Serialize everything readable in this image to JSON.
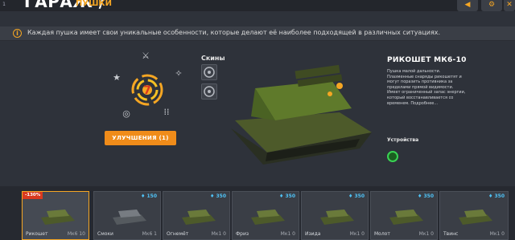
{
  "header": {
    "title": "ГАРАЖ /",
    "subtitle": "ПУШКИ",
    "left_tag": "1"
  },
  "info": {
    "icon": "i",
    "text": "Каждая пушка имеет свои уникальные особенности, которые делают её наиболее подходящей в различных ситуациях."
  },
  "upgrades": {
    "button_label": "УЛУЧШЕНИЯ (1)",
    "center_value": "7"
  },
  "skins": {
    "label": "Скины"
  },
  "weapon": {
    "name": "РИКОШЕТ МК6-10",
    "description": "Пушка малой дальности. Плазменные снаряды рикошетят и могут поразить противника за пределами прямой видимости. Имеет ограниченный запас энергии, который восстанавливается со временем. Подробнее..."
  },
  "devices": {
    "label": "Устройства"
  },
  "cards": [
    {
      "name": "Рикошет",
      "mk": "Мк6 10",
      "badge": "-130%",
      "price": ""
    },
    {
      "name": "Смоки",
      "mk": "Мк6 1",
      "badge": "",
      "price": "150"
    },
    {
      "name": "Огнемёт",
      "mk": "Мк1 0",
      "badge": "",
      "price": "350"
    },
    {
      "name": "Фриз",
      "mk": "Мк1 0",
      "badge": "",
      "price": "350"
    },
    {
      "name": "Изида",
      "mk": "Мк1 0",
      "badge": "",
      "price": "350"
    },
    {
      "name": "Молот",
      "mk": "Мк1 0",
      "badge": "",
      "price": "350"
    },
    {
      "name": "Твинс",
      "mk": "Мк1 0",
      "badge": "",
      "price": "350"
    }
  ],
  "colors": {
    "accent": "#f5a623",
    "upgrade_button": "#f08c1a",
    "price": "#4fc3f7",
    "sale_badge": "#d9391f"
  }
}
